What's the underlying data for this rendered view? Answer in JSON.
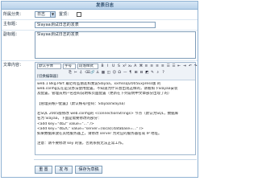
{
  "header": {
    "title": "发表日志"
  },
  "form": {
    "category_label": "所属分类：",
    "category_value": "日志",
    "top_label": "置顶：",
    "title_label": "主标题：",
    "title_value": "Slayaa测试日志的发表",
    "subtitle_label": "副标题：",
    "subtitle_value": "Slayaa测试日志的发表",
    "content_label": "文章内容："
  },
  "toolbar": {
    "font_select": "默认字体",
    "size_select": "字号",
    "format_select": "段落样式",
    "buttons_row1": [
      "B",
      "I",
      "U",
      "S",
      "x²",
      "x₂",
      "A",
      "⌘",
      "≡",
      "≡",
      "≡",
      "≡",
      "☰",
      "☰",
      "⇤",
      "⇥",
      "↶",
      "↷"
    ],
    "buttons_row2": [
      "⎘",
      "✂",
      "⎀",
      "⌫",
      "🔗",
      "⚓",
      "▦",
      "◫",
      "☺",
      "Ω",
      "—",
      "¶",
      "⊞",
      "⊟",
      "◩",
      "✎",
      "⌕",
      "?"
    ],
    "mode_label": "[切换编辑器]"
  },
  "content": {
    "lines": [
      "web.1 Bkg.Part 最近有些朋友和我说Slayaa，xxmssql2005Express版 的",
      "web.config实在是没办法使用配置，不知道为什么会出现这样的，请看如下Slayaa安装",
      "及配置，管理员用户名密码说明和页面配置（更新在下列说明中文章部分出现了的）",
      "",
      "【管理员帐户配置】（默认帐号/密码：Slayaa/Slayaa）",
      "",
      "若SQL 2005版修改 web.config的 <connectionStrings> 节点（默认为SQL，数据库",
      "名为 Slayaa，下面是需要修改的部分：",
      "  <add key=\"db2\" value=\"...\" />",
      "  <add key=\"db2C\" value=\"server=(local);database=...\" />",
      "如果数据库放在其他服务器上，请修改 server 为对应的服务器名或 IP 地址。",
      "",
      "注意：请不要修改 key 的值，否则系统无法正常工作。"
    ]
  },
  "actions": {
    "reset_label": "重 置",
    "publish_label": "发 布",
    "save_draft_label": "保存为草稿"
  }
}
